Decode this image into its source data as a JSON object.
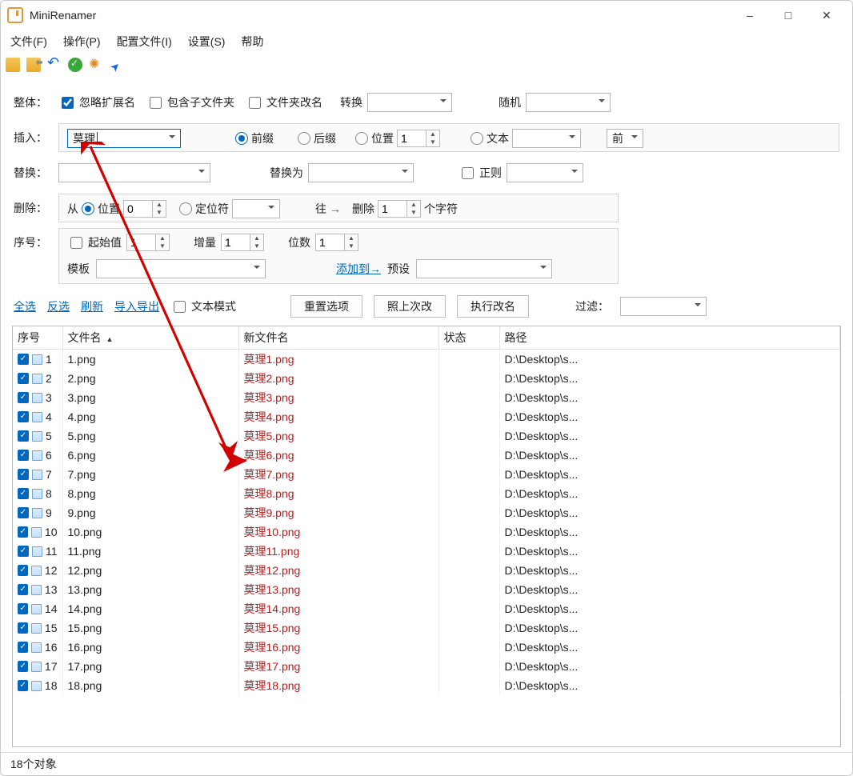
{
  "title": "MiniRenamer",
  "menu": {
    "file": "文件(F)",
    "action": "操作(P)",
    "config": "配置文件(I)",
    "settings": "设置(S)",
    "help": "帮助"
  },
  "labels": {
    "overall": "整体：",
    "ignoreExt": "忽略扩展名",
    "includeSub": "包含子文件夹",
    "folderRename": "文件夹改名",
    "convert": "转换",
    "random": "随机",
    "insert": "插入：",
    "prefix": "前缀",
    "suffix": "后缀",
    "position": "位置",
    "text": "文本",
    "front": "前",
    "replace": "替换：",
    "replaceTo": "替换为",
    "regex": "正则",
    "delete": "删除：",
    "from": "从",
    "pos": "位置",
    "locator": "定位符",
    "to": "往",
    "delCount": "删除",
    "nChars": "个字符",
    "seq": "序号：",
    "startVal": "起始值",
    "increment": "增量",
    "digits": "位数",
    "template": "模板",
    "addTo": "添加到→",
    "preset": "预设",
    "selectAll": "全选",
    "inverse": "反选",
    "refresh": "刷新",
    "importExport": "导入导出",
    "textMode": "文本模式",
    "resetOptions": "重置选项",
    "asLastTime": "照上次改",
    "execute": "执行改名",
    "filter": "过滤："
  },
  "values": {
    "insertText": "莫理",
    "posVal": "1",
    "fromPos": "0",
    "delCount": "1",
    "startVal": "1",
    "increment": "1",
    "digits": "1",
    "arrowTo": "→"
  },
  "columns": {
    "idx": "序号",
    "name": "文件名",
    "newName": "新文件名",
    "status": "状态",
    "path": "路径"
  },
  "rows": [
    {
      "n": "1",
      "name": "1.png",
      "new": "莫理1.png",
      "path": "D:\\Desktop\\s..."
    },
    {
      "n": "2",
      "name": "2.png",
      "new": "莫理2.png",
      "path": "D:\\Desktop\\s..."
    },
    {
      "n": "3",
      "name": "3.png",
      "new": "莫理3.png",
      "path": "D:\\Desktop\\s..."
    },
    {
      "n": "4",
      "name": "4.png",
      "new": "莫理4.png",
      "path": "D:\\Desktop\\s..."
    },
    {
      "n": "5",
      "name": "5.png",
      "new": "莫理5.png",
      "path": "D:\\Desktop\\s..."
    },
    {
      "n": "6",
      "name": "6.png",
      "new": "莫理6.png",
      "path": "D:\\Desktop\\s..."
    },
    {
      "n": "7",
      "name": "7.png",
      "new": "莫理7.png",
      "path": "D:\\Desktop\\s..."
    },
    {
      "n": "8",
      "name": "8.png",
      "new": "莫理8.png",
      "path": "D:\\Desktop\\s..."
    },
    {
      "n": "9",
      "name": "9.png",
      "new": "莫理9.png",
      "path": "D:\\Desktop\\s..."
    },
    {
      "n": "10",
      "name": "10.png",
      "new": "莫理10.png",
      "path": "D:\\Desktop\\s..."
    },
    {
      "n": "11",
      "name": "11.png",
      "new": "莫理11.png",
      "path": "D:\\Desktop\\s..."
    },
    {
      "n": "12",
      "name": "12.png",
      "new": "莫理12.png",
      "path": "D:\\Desktop\\s..."
    },
    {
      "n": "13",
      "name": "13.png",
      "new": "莫理13.png",
      "path": "D:\\Desktop\\s..."
    },
    {
      "n": "14",
      "name": "14.png",
      "new": "莫理14.png",
      "path": "D:\\Desktop\\s..."
    },
    {
      "n": "15",
      "name": "15.png",
      "new": "莫理15.png",
      "path": "D:\\Desktop\\s..."
    },
    {
      "n": "16",
      "name": "16.png",
      "new": "莫理16.png",
      "path": "D:\\Desktop\\s..."
    },
    {
      "n": "17",
      "name": "17.png",
      "new": "莫理17.png",
      "path": "D:\\Desktop\\s..."
    },
    {
      "n": "18",
      "name": "18.png",
      "new": "莫理18.png",
      "path": "D:\\Desktop\\s..."
    }
  ],
  "statusbar": "18个对象"
}
